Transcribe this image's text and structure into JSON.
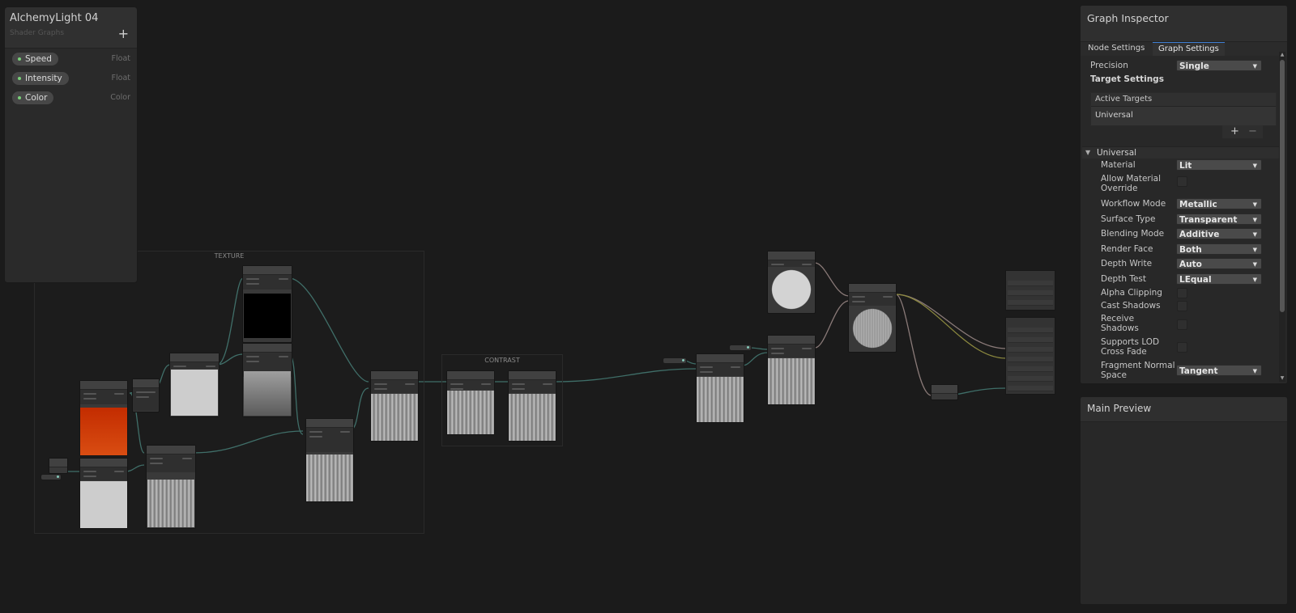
{
  "blackboard": {
    "title": "AlchemyLight 04",
    "subtitle": "Shader Graphs",
    "add_label": "+",
    "properties": [
      {
        "name": "Speed",
        "type": "Float"
      },
      {
        "name": "Intensity",
        "type": "Float"
      },
      {
        "name": "Color",
        "type": "Color"
      }
    ]
  },
  "graph": {
    "groups": [
      {
        "title": "TEXTURE"
      },
      {
        "title": "CONTRAST"
      }
    ]
  },
  "inspector": {
    "title": "Graph Inspector",
    "tabs": [
      {
        "label": "Node Settings",
        "active": false
      },
      {
        "label": "Graph Settings",
        "active": true
      }
    ],
    "precision_label": "Precision",
    "precision_value": "Single",
    "target_settings_label": "Target Settings",
    "active_targets_label": "Active Targets",
    "active_target": "Universal",
    "plus_label": "+",
    "minus_label": "−",
    "section_title": "Universal",
    "settings": [
      {
        "label": "Material",
        "value": "Lit"
      },
      {
        "label": "Allow Material Override",
        "checkbox": false
      },
      {
        "label": "Workflow Mode",
        "value": "Metallic"
      },
      {
        "label": "Surface Type",
        "value": "Transparent"
      },
      {
        "label": "Blending Mode",
        "value": "Additive"
      },
      {
        "label": "Render Face",
        "value": "Both"
      },
      {
        "label": "Depth Write",
        "value": "Auto"
      },
      {
        "label": "Depth Test",
        "value": "LEqual"
      },
      {
        "label": "Alpha Clipping",
        "checkbox": false
      },
      {
        "label": "Cast Shadows",
        "checkbox": false
      },
      {
        "label": "Receive Shadows",
        "checkbox": false
      },
      {
        "label": "Supports LOD Cross Fade",
        "checkbox": false
      },
      {
        "label": "Fragment Normal Space",
        "value": "Tangent"
      }
    ]
  },
  "main_preview": {
    "title": "Main Preview"
  },
  "colors": {
    "background": "#1b1b1b",
    "panel": "#282828",
    "wire": "#3f6e68",
    "wire_vector": "#8a7a78",
    "accent_tab": "#3f7fd4",
    "property_dot": "#7ad07a"
  }
}
